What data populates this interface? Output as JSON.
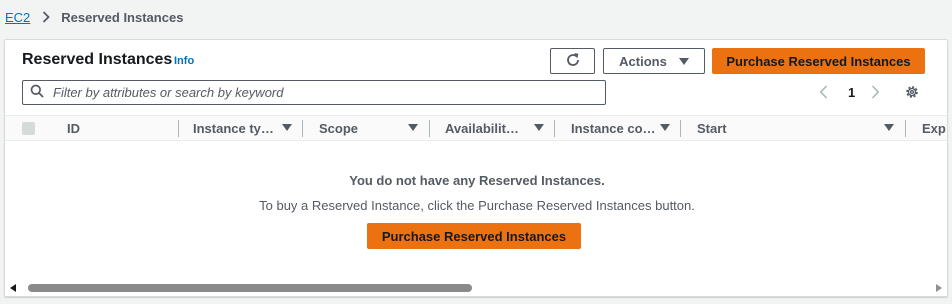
{
  "breadcrumb": {
    "root": "EC2",
    "current": "Reserved Instances"
  },
  "header": {
    "title": "Reserved Instances",
    "info": "Info",
    "actions_label": "Actions",
    "purchase_label": "Purchase Reserved Instances"
  },
  "search": {
    "placeholder": "Filter by attributes or search by keyword",
    "value": ""
  },
  "pagination": {
    "current_page": "1"
  },
  "table": {
    "columns": [
      "ID",
      "Instance ty…",
      "Scope",
      "Availabilit…",
      "Instance co…",
      "Start",
      "Exp"
    ]
  },
  "empty_state": {
    "title": "You do not have any Reserved Instances.",
    "description": "To buy a Reserved Instance, click the Purchase Reserved Instances button.",
    "button_label": "Purchase Reserved Instances"
  },
  "colors": {
    "primary": "#ec7211",
    "link": "#0073bb",
    "text_secondary": "#545b64",
    "border": "#d5dbdb"
  },
  "icons": [
    "chevron-right-icon",
    "refresh-icon",
    "caret-down-icon",
    "search-icon",
    "chevron-left-icon",
    "chevron-right-icon",
    "settings-icon",
    "sort-icon"
  ]
}
